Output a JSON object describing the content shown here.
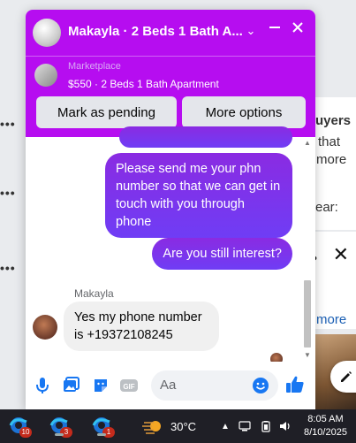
{
  "background": {
    "dots": "•••",
    "snippet_buyers": "uyers",
    "snippet_that": "that",
    "snippet_more": "more",
    "snippet_year": "ear:",
    "snippet_more2": "more"
  },
  "chat": {
    "header": {
      "title": "Makayla · 2 Beds 1 Bath A...",
      "marketplace_label": "Marketplace",
      "listing": "$550 · 2 Beds 1 Bath Apartment",
      "mark_pending_label": "Mark as pending",
      "more_options_label": "More options",
      "accent_color": "#b60df0"
    },
    "messages": {
      "outgoing": [
        "Please send me your phn number so that we can get in touch with you through phone",
        "Are you still interest?"
      ],
      "sender_name": "Makayla",
      "incoming": [
        "Yes my phone number is +19372108245"
      ]
    },
    "composer": {
      "placeholder": "Aa",
      "icons": [
        "microphone-icon",
        "photo-icon",
        "sticker-icon",
        "gif-icon",
        "emoji-icon",
        "like-icon"
      ]
    }
  },
  "taskbar": {
    "apps": [
      {
        "badge": "10"
      },
      {
        "badge": "3"
      },
      {
        "badge": "1"
      }
    ],
    "temperature": "30°C",
    "time": "8:05 AM",
    "date": "8/10/2025"
  }
}
